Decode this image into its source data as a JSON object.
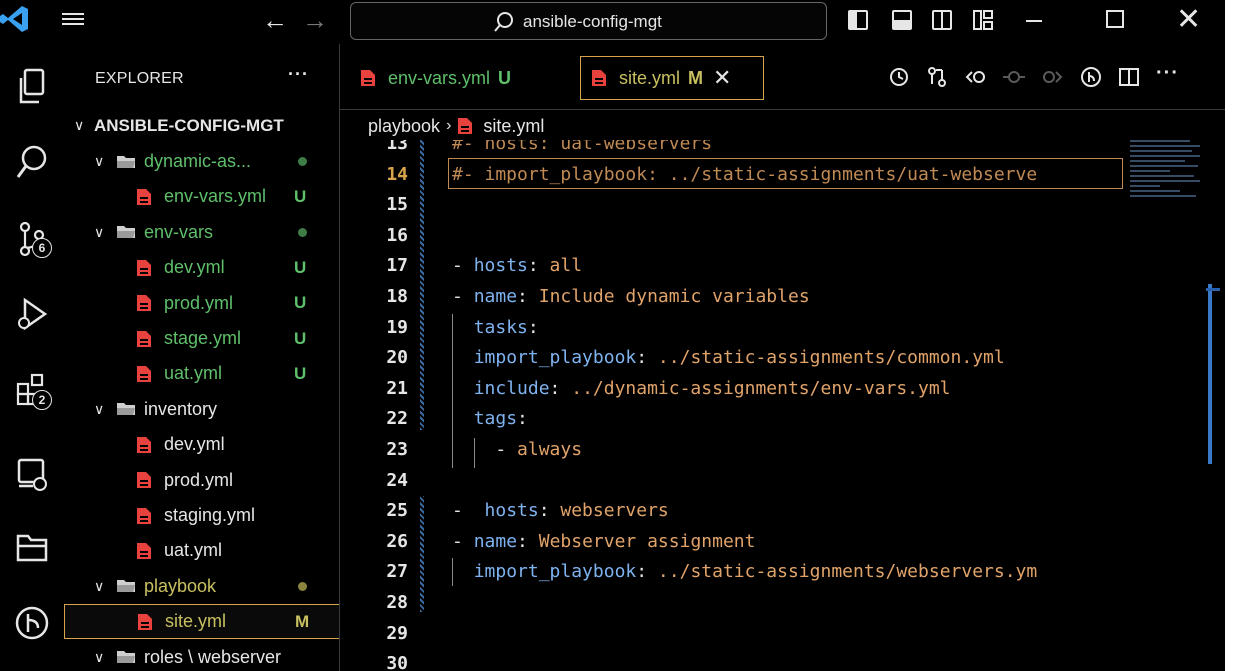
{
  "titlebar": {
    "search_text": "ansible-config-mgt"
  },
  "activity": {
    "source_control_badge": "6",
    "extensions_badge": "2"
  },
  "explorer": {
    "title": "EXPLORER",
    "more": "···",
    "root": "ANSIBLE-CONFIG-MGT",
    "rows": [
      {
        "label": "dynamic-as...",
        "type": "folder",
        "depth": 1,
        "status": "dot",
        "color": "green"
      },
      {
        "label": "env-vars.yml",
        "type": "file",
        "depth": 2,
        "status": "U",
        "color": "green"
      },
      {
        "label": "env-vars",
        "type": "folder",
        "depth": 1,
        "status": "dot",
        "color": "green"
      },
      {
        "label": "dev.yml",
        "type": "file",
        "depth": 2,
        "status": "U",
        "color": "green"
      },
      {
        "label": "prod.yml",
        "type": "file",
        "depth": 2,
        "status": "U",
        "color": "green"
      },
      {
        "label": "stage.yml",
        "type": "file",
        "depth": 2,
        "status": "U",
        "color": "green"
      },
      {
        "label": "uat.yml",
        "type": "file",
        "depth": 2,
        "status": "U",
        "color": "green"
      },
      {
        "label": "inventory",
        "type": "folder",
        "depth": 1,
        "status": "",
        "color": "white"
      },
      {
        "label": "dev.yml",
        "type": "file",
        "depth": 2,
        "status": "",
        "color": "white"
      },
      {
        "label": "prod.yml",
        "type": "file",
        "depth": 2,
        "status": "",
        "color": "white"
      },
      {
        "label": "staging.yml",
        "type": "file",
        "depth": 2,
        "status": "",
        "color": "white"
      },
      {
        "label": "uat.yml",
        "type": "file",
        "depth": 2,
        "status": "",
        "color": "white"
      },
      {
        "label": "playbook",
        "type": "folder",
        "depth": 1,
        "status": "dot",
        "color": "olive"
      },
      {
        "label": "site.yml",
        "type": "file",
        "depth": 2,
        "status": "M",
        "color": "olive",
        "selected": true
      },
      {
        "label": "roles \\ webserver",
        "type": "folder",
        "depth": 1,
        "status": "",
        "color": "white"
      }
    ]
  },
  "tabs": [
    {
      "label": "env-vars.yml",
      "status": "U",
      "active": false
    },
    {
      "label": "site.yml",
      "status": "M",
      "active": true,
      "close": "✕"
    }
  ],
  "breadcrumb": {
    "folder": "playbook",
    "file": "site.yml"
  },
  "code_lines": [
    {
      "n": "13",
      "text": "#- hosts: uat-webservers"
    },
    {
      "n": "14",
      "text": "#- import_playbook: ../static-assignments/uat-webserve"
    },
    {
      "n": "15",
      "text": ""
    },
    {
      "n": "16",
      "text": ""
    },
    {
      "n": "17",
      "text": "- hosts: all"
    },
    {
      "n": "18",
      "text": "- name: Include dynamic variables"
    },
    {
      "n": "19",
      "text": "  tasks:"
    },
    {
      "n": "20",
      "text": "  import_playbook: ../static-assignments/common.yml"
    },
    {
      "n": "21",
      "text": "  include: ../dynamic-assignments/env-vars.yml"
    },
    {
      "n": "22",
      "text": "  tags:"
    },
    {
      "n": "23",
      "text": "    - always"
    },
    {
      "n": "24",
      "text": ""
    },
    {
      "n": "25",
      "text": "-  hosts: webservers"
    },
    {
      "n": "26",
      "text": "- name: Webserver assignment"
    },
    {
      "n": "27",
      "text": "  import_playbook: ../static-assignments/webservers.ym"
    },
    {
      "n": "28",
      "text": ""
    },
    {
      "n": "29",
      "text": ""
    },
    {
      "n": "30",
      "text": ""
    }
  ],
  "colors": {
    "accent_border": "#d8a44a",
    "untracked": "#5fbf6b",
    "modified": "#c8c060",
    "yaml_key": "#7fb3f0",
    "yaml_value": "#e0a36a",
    "file_icon": "#e8423f"
  },
  "icons": {
    "activity": [
      "explorer-icon",
      "search-icon",
      "source-control-icon",
      "run-debug-icon",
      "extensions-icon",
      "remote-explorer-icon",
      "folder-icon",
      "git-graph-icon"
    ],
    "editor_actions": [
      "timeline-icon",
      "compare-changes-icon",
      "go-back-icon",
      "commit-icon",
      "go-forward-icon",
      "git-lens-icon",
      "split-editor-icon",
      "more-actions-icon"
    ]
  }
}
